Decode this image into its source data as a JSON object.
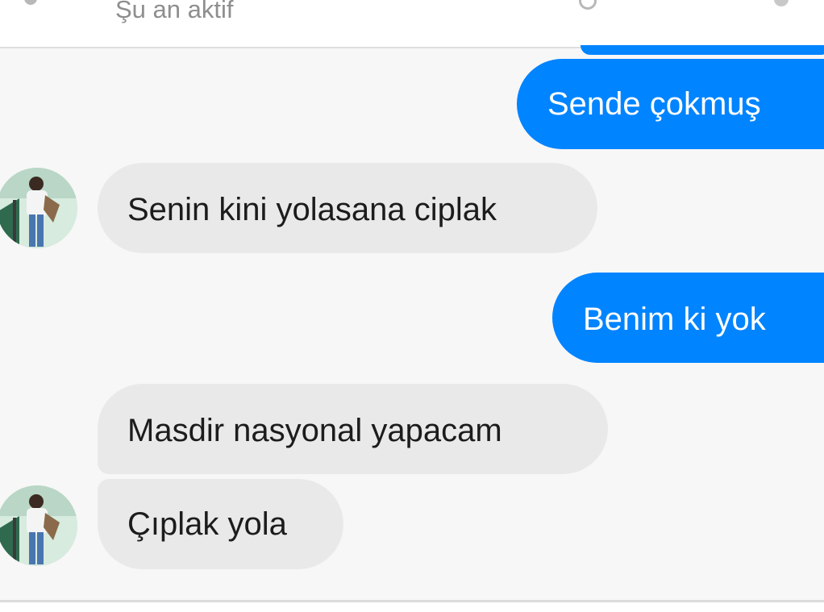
{
  "header": {
    "status_text": "Şu an aktif",
    "icons": [
      "back-icon",
      "call-icon",
      "info-icon"
    ]
  },
  "colors": {
    "outgoing_bubble": "#0084ff",
    "incoming_bubble": "#e9e9e9",
    "background": "#f7f7f7"
  },
  "messages": [
    {
      "direction": "outgoing",
      "text": "Sende çokmuş"
    },
    {
      "direction": "incoming",
      "text": "Senin kini yolasana ciplak"
    },
    {
      "direction": "outgoing",
      "text": "Benim ki yok"
    },
    {
      "direction": "incoming",
      "text": "Masdir nasyonal yapacam"
    },
    {
      "direction": "incoming",
      "text": "Çıplak yola"
    }
  ]
}
